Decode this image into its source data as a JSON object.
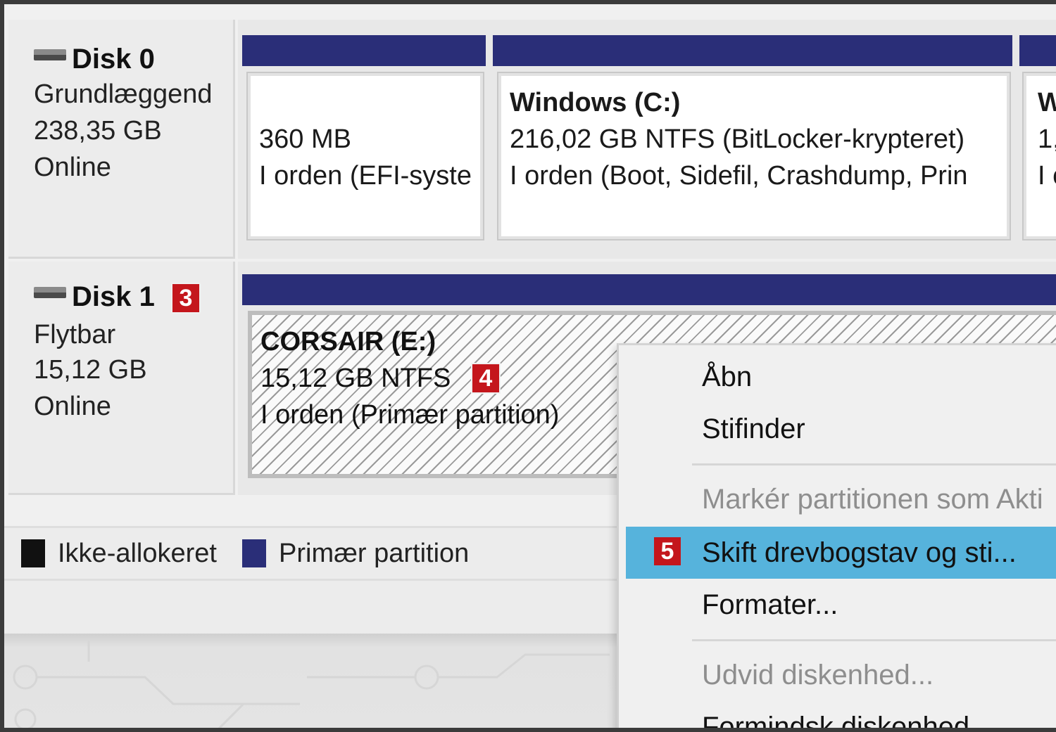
{
  "disks": [
    {
      "title": "Disk 0",
      "type": "Grundlæggend",
      "size": "238,35 GB",
      "status": "Online",
      "partitions": [
        {
          "name": "",
          "size": "360 MB",
          "status": "I orden (EFI-syste"
        },
        {
          "name": "Windows  (C:)",
          "size": "216,02 GB NTFS (BitLocker-krypteret)",
          "status": "I orden (Boot, Sidefil, Crashdump, Prin"
        },
        {
          "name": "W",
          "size": "1,",
          "status": "I c"
        }
      ]
    },
    {
      "title": "Disk 1",
      "badge": "3",
      "type": "Flytbar",
      "size": "15,12 GB",
      "status": "Online",
      "partitions": [
        {
          "name": "CORSAIR  (E:)",
          "size": "15,12 GB NTFS",
          "size_badge": "4",
          "status": "I orden (Primær partition)"
        }
      ]
    }
  ],
  "legend": [
    {
      "label": "Ikke-allokeret",
      "color": "#111111"
    },
    {
      "label": "Primær partition",
      "color": "#2a2e78"
    }
  ],
  "context_menu": {
    "items": [
      {
        "label": "Åbn",
        "enabled": true
      },
      {
        "label": "Stifinder",
        "enabled": true
      },
      {
        "label": "Markér partitionen som Akti",
        "enabled": false
      },
      {
        "label": "Skift drevbogstav og sti...",
        "enabled": true,
        "highlighted": true,
        "badge": "5"
      },
      {
        "label": "Formater...",
        "enabled": true
      },
      {
        "label": "Udvid diskenhed...",
        "enabled": false
      },
      {
        "label": "Formindsk diskenhed...",
        "enabled": true
      }
    ]
  },
  "colors": {
    "primary_partition": "#2a2e78",
    "highlight": "#56b3dc",
    "badge": "#c4161c"
  }
}
